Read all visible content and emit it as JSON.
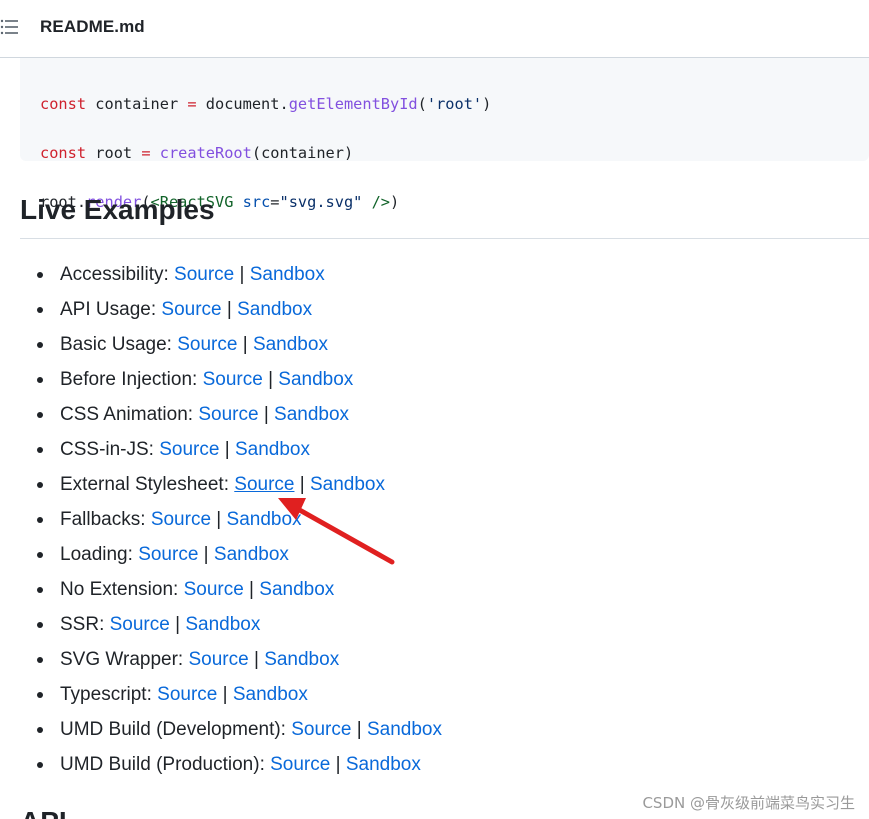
{
  "header": {
    "file_title": "README.md"
  },
  "code": {
    "line1": {
      "kw": "const",
      "name": " container ",
      "op": "=",
      "obj": " document.",
      "fn": "getElementById",
      "open": "(",
      "str": "'root'",
      "close": ")"
    },
    "line2": {
      "kw": "const",
      "name": " root ",
      "op": "=",
      "fn": " createRoot",
      "args": "(container)"
    },
    "line3": {
      "obj": "root.",
      "fn": "render",
      "open": "(",
      "tag_open": "<ReactSVG",
      "attr": " src",
      "eq": "=",
      "str": "\"svg.svg\"",
      "tag_close": " />",
      "close": ")"
    }
  },
  "section": {
    "heading": "Live Examples",
    "next_heading": "API"
  },
  "examples": [
    {
      "label": "Accessibility: ",
      "source": "Source",
      "sep": " | ",
      "sandbox": "Sandbox"
    },
    {
      "label": "API Usage: ",
      "source": "Source",
      "sep": " | ",
      "sandbox": "Sandbox"
    },
    {
      "label": "Basic Usage: ",
      "source": "Source",
      "sep": " | ",
      "sandbox": "Sandbox"
    },
    {
      "label": "Before Injection: ",
      "source": "Source",
      "sep": " | ",
      "sandbox": "Sandbox"
    },
    {
      "label": "CSS Animation: ",
      "source": "Source",
      "sep": " | ",
      "sandbox": "Sandbox"
    },
    {
      "label": "CSS-in-JS: ",
      "source": "Source",
      "sep": " | ",
      "sandbox": "Sandbox"
    },
    {
      "label": "External Stylesheet: ",
      "source": "Source",
      "sep": " | ",
      "sandbox": "Sandbox"
    },
    {
      "label": "Fallbacks: ",
      "source": "Source",
      "sep": " | ",
      "sandbox": "Sandbox"
    },
    {
      "label": "Loading: ",
      "source": "Source",
      "sep": " | ",
      "sandbox": "Sandbox"
    },
    {
      "label": "No Extension: ",
      "source": "Source",
      "sep": " | ",
      "sandbox": "Sandbox"
    },
    {
      "label": "SSR: ",
      "source": "Source",
      "sep": " | ",
      "sandbox": "Sandbox"
    },
    {
      "label": "SVG Wrapper: ",
      "source": "Source",
      "sep": " | ",
      "sandbox": "Sandbox"
    },
    {
      "label": "Typescript: ",
      "source": "Source",
      "sep": " | ",
      "sandbox": "Sandbox"
    },
    {
      "label": "UMD Build (Development): ",
      "source": "Source",
      "sep": " | ",
      "sandbox": "Sandbox"
    },
    {
      "label": "UMD Build (Production): ",
      "source": "Source",
      "sep": " | ",
      "sandbox": "Sandbox"
    }
  ],
  "annotation": {
    "arrow_color": "#e02020",
    "points_to": "External Stylesheet Source link"
  },
  "watermark": "CSDN @骨灰级前端菜鸟实习生",
  "colors": {
    "link": "#0969da",
    "text": "#1f2328",
    "code_bg": "#f6f8fa",
    "keyword": "#cf222e",
    "function": "#8250df"
  },
  "icons": {
    "toc": "list-icon"
  }
}
